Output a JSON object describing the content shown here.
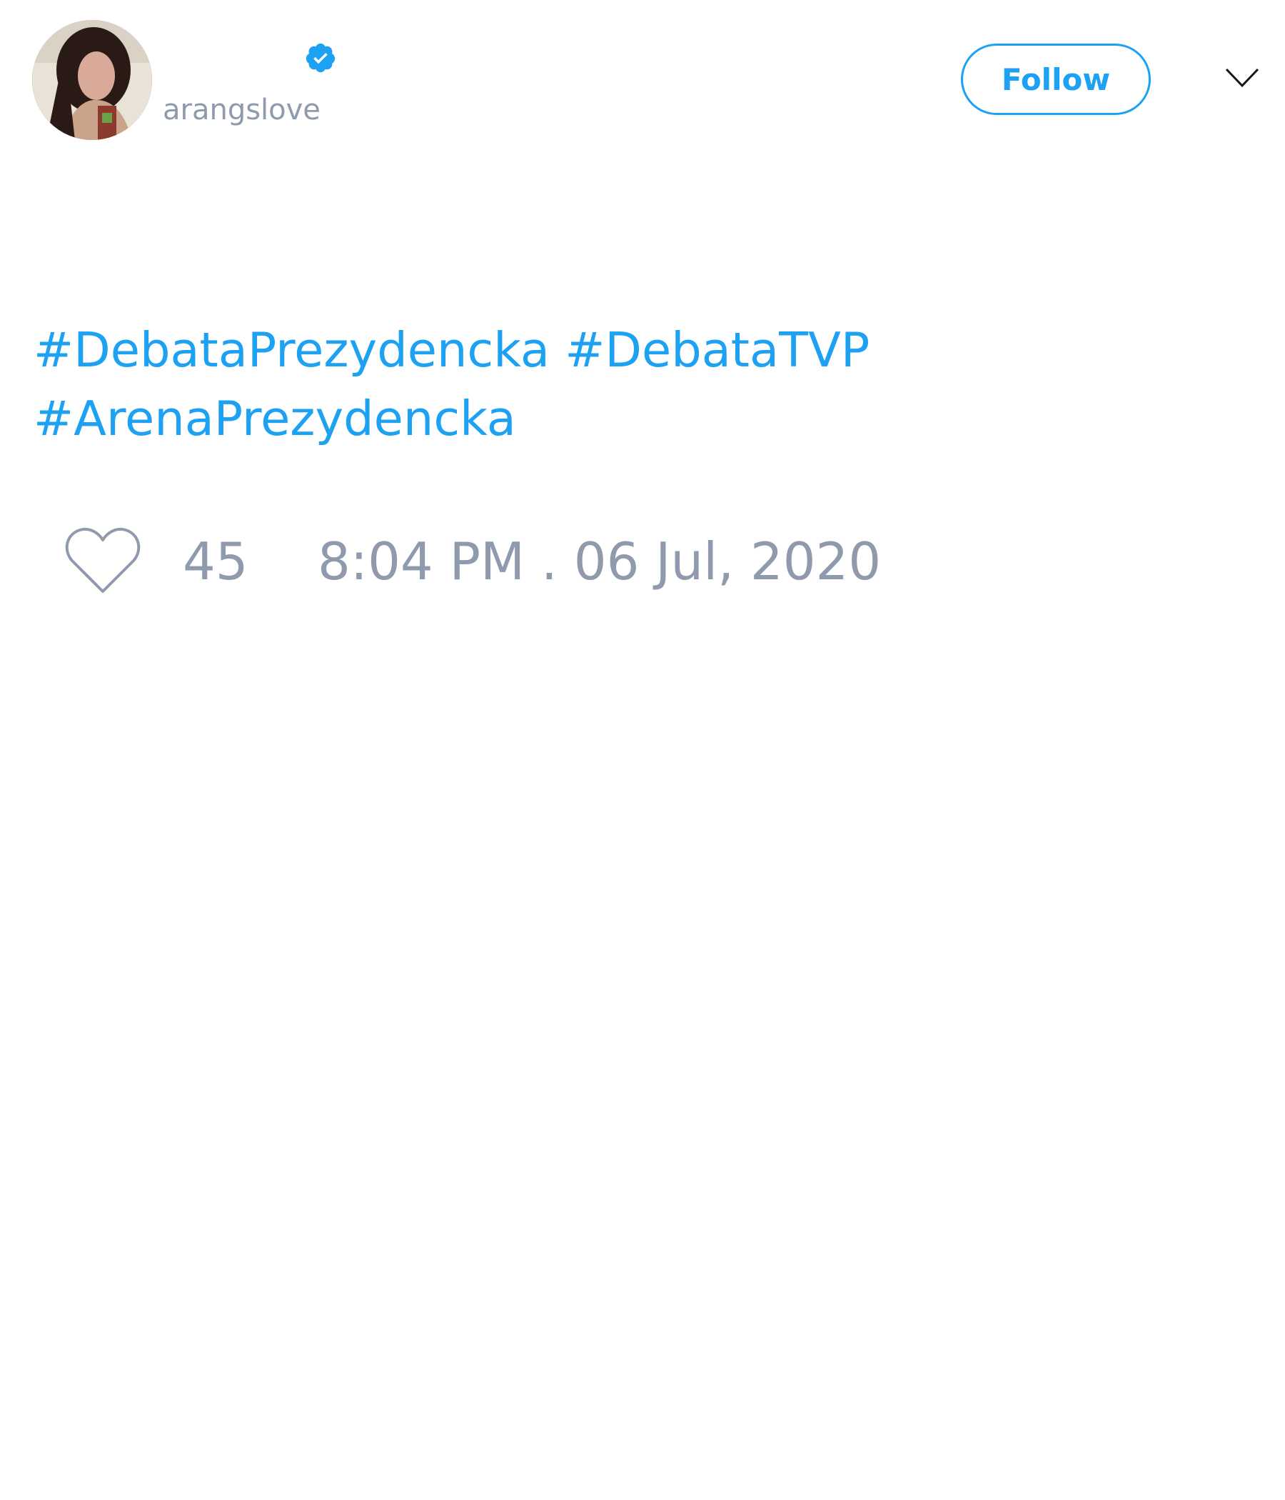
{
  "tweet": {
    "display_name": "",
    "username": "arangslove",
    "follow_label": "Follow",
    "hashtags": [
      "#DebataPrezydencka",
      "#DebataTVP",
      "#ArenaPrezydencka"
    ],
    "like_count": "45",
    "timestamp": "8:04 PM . 06 Jul, 2020"
  },
  "icons": {
    "verified": "verified-badge-icon",
    "more": "chevron-down-icon",
    "like": "heart-icon"
  },
  "colors": {
    "accent": "#1da1f2",
    "muted": "#8f9aad",
    "text": "#14171a"
  }
}
